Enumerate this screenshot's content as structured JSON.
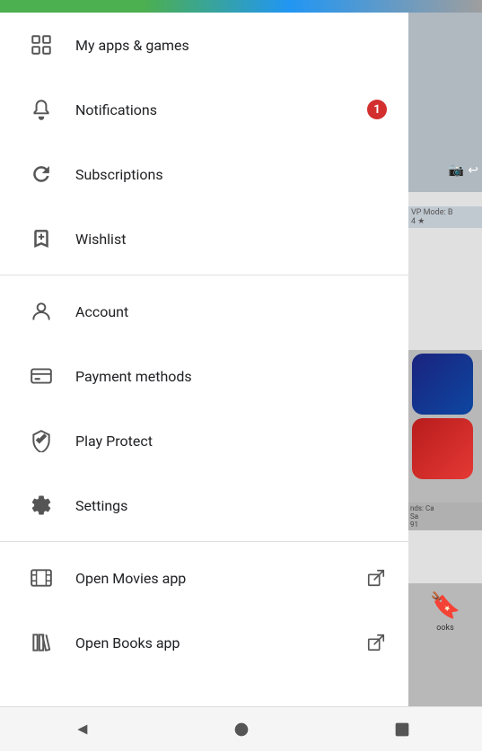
{
  "header": {
    "colors": {
      "green": "#4CAF50",
      "blue": "#2196F3",
      "gray": "#9E9E9E"
    }
  },
  "menu": {
    "items": [
      {
        "id": "my-apps-games",
        "label": "My apps & games",
        "icon": "grid-icon",
        "badge": null,
        "external": false
      },
      {
        "id": "notifications",
        "label": "Notifications",
        "icon": "bell-icon",
        "badge": "1",
        "external": false
      },
      {
        "id": "subscriptions",
        "label": "Subscriptions",
        "icon": "refresh-icon",
        "badge": null,
        "external": false
      },
      {
        "id": "wishlist",
        "label": "Wishlist",
        "icon": "bookmark-icon",
        "badge": null,
        "external": false
      }
    ],
    "divider1": true,
    "items2": [
      {
        "id": "account",
        "label": "Account",
        "icon": "person-icon",
        "badge": null,
        "external": false
      },
      {
        "id": "payment-methods",
        "label": "Payment methods",
        "icon": "credit-card-icon",
        "badge": null,
        "external": false
      },
      {
        "id": "play-protect",
        "label": "Play Protect",
        "icon": "shield-icon",
        "badge": null,
        "external": false
      },
      {
        "id": "settings",
        "label": "Settings",
        "icon": "gear-icon",
        "badge": null,
        "external": false
      }
    ],
    "divider2": true,
    "items3": [
      {
        "id": "open-movies",
        "label": "Open Movies app",
        "icon": "film-icon",
        "badge": null,
        "external": true
      },
      {
        "id": "open-books",
        "label": "Open Books app",
        "icon": "books-icon",
        "badge": null,
        "external": true
      }
    ]
  },
  "nav": {
    "back_label": "back",
    "home_label": "home",
    "recents_label": "recents"
  }
}
